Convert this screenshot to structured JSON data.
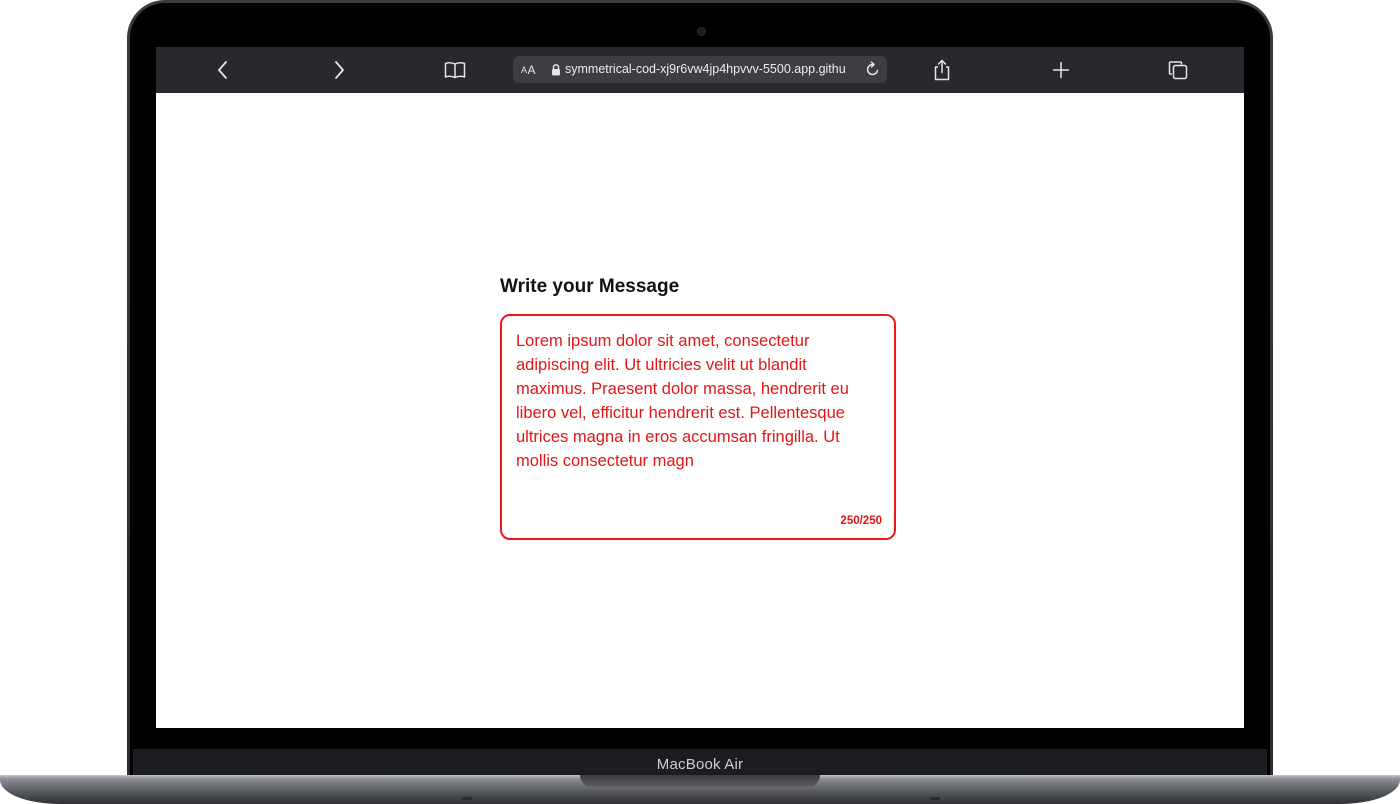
{
  "browser": {
    "address_text_size_small": "A",
    "address_text_size_big": "A",
    "url": "symmetrical-cod-xj9r6vw4jp4hpvvv-5500.app.githu"
  },
  "page": {
    "title": "Write your Message",
    "message": "Lorem ipsum dolor sit amet, consectetur adipiscing elit. Ut ultricies velit ut blandit maximus. Praesent dolor massa, hendrerit eu libero vel, efficitur hendrerit est. Pellentesque ultrices magna in eros accumsan fringilla. Ut mollis consectetur magn",
    "char_count": "250/250"
  },
  "device": {
    "label": "MacBook Air"
  },
  "colors": {
    "accent_error": "#e51414",
    "toolbar_bg": "#27292d"
  },
  "icons": {
    "back": "chevron-left-icon",
    "forward": "chevron-right-icon",
    "bookmarks": "book-icon",
    "lock": "lock-icon",
    "reload": "reload-icon",
    "share": "share-icon",
    "new_tab": "plus-icon",
    "tabs": "tabs-icon"
  }
}
